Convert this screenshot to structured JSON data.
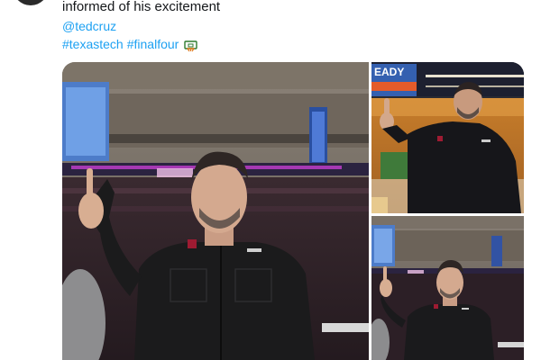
{
  "tweet": {
    "text_line": "informed of his excitement",
    "mention": "@tedcruz",
    "hashtags": [
      "#texastech",
      "#finalfour"
    ],
    "emoji_icon": "basketball-hoop-emoji"
  },
  "media": {
    "photos": [
      {
        "name": "main-photo",
        "scoreboard_text": ""
      },
      {
        "name": "top-right-photo",
        "scoreboard_text": "EADY"
      },
      {
        "name": "bottom-right-photo",
        "scoreboard_text": ""
      }
    ]
  },
  "colors": {
    "link": "#1da1f2",
    "text": "#14171a",
    "shirt": "#1a1a1a"
  }
}
